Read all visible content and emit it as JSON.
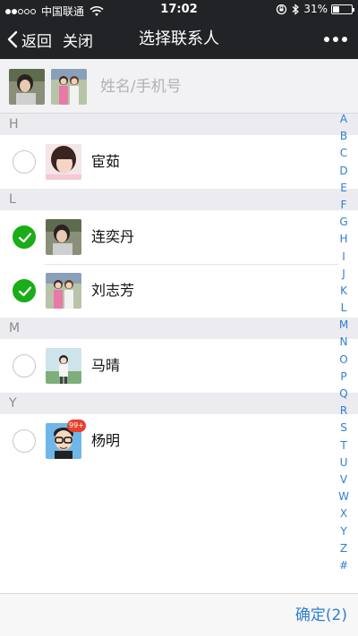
{
  "status_bar": {
    "carrier": "中国联通",
    "time": "17:02",
    "battery": "31%",
    "battery_level": 0.31,
    "signal_bars": 2
  },
  "nav": {
    "back_label": "返回",
    "close_label": "关闭",
    "title": "选择联系人"
  },
  "search": {
    "placeholder": "姓名/手机号",
    "value": ""
  },
  "sections": [
    {
      "letter": "H",
      "contacts": [
        {
          "name": "宦茹",
          "checked": false
        }
      ]
    },
    {
      "letter": "L",
      "contacts": [
        {
          "name": "连奕丹",
          "checked": true
        },
        {
          "name": "刘志芳",
          "checked": true
        }
      ]
    },
    {
      "letter": "M",
      "contacts": [
        {
          "name": "马晴",
          "checked": false
        }
      ]
    },
    {
      "letter": "Y",
      "contacts": [
        {
          "name": "杨明",
          "checked": false,
          "badge": "99+"
        }
      ]
    }
  ],
  "index_letters": [
    "A",
    "B",
    "C",
    "D",
    "E",
    "F",
    "G",
    "H",
    "I",
    "J",
    "K",
    "L",
    "M",
    "N",
    "O",
    "P",
    "Q",
    "R",
    "S",
    "T",
    "U",
    "V",
    "W",
    "X",
    "Y",
    "Z",
    "#"
  ],
  "confirm_label": "确定(2)",
  "colors": {
    "bar_dark": "#222326",
    "check_green": "#1aad19",
    "link_blue": "#2f7fd1",
    "badge_red": "#e8412c"
  },
  "icons": {
    "back": "chevron-left-icon",
    "more": "more-dots-icon",
    "check": "checkmark-icon",
    "wifi": "wifi-icon",
    "lock_rotation": "rotation-lock-icon",
    "bluetooth": "bluetooth-icon"
  }
}
